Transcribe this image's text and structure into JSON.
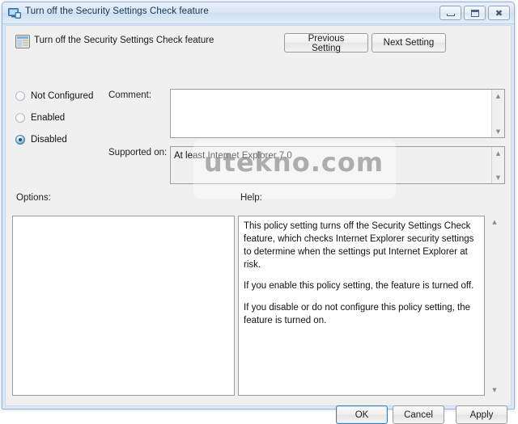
{
  "window": {
    "title": "Turn off the Security Settings Check feature",
    "title_icon": "policy-monitor-icon",
    "buttons": {
      "minimize": "minimize-icon",
      "maximize": "maximize-icon",
      "close": "close-icon"
    }
  },
  "header": {
    "icon": "policy-setting-icon",
    "policy_title": "Turn off the Security Settings Check feature",
    "previous_setting": "Previous Setting",
    "next_setting": "Next Setting"
  },
  "state_options": [
    {
      "label": "Not Configured",
      "selected": false
    },
    {
      "label": "Enabled",
      "selected": false
    },
    {
      "label": "Disabled",
      "selected": true
    }
  ],
  "fields": {
    "comment_label": "Comment:",
    "comment_value": "",
    "supported_label": "Supported on:",
    "supported_value": "At least Internet Explorer 7.0"
  },
  "panes": {
    "options_label": "Options:",
    "options_value": "",
    "help_label": "Help:",
    "help_paragraphs": [
      "This policy setting turns off the Security Settings Check feature, which checks Internet Explorer security settings to determine when the settings put Internet Explorer at risk.",
      "If you enable this policy setting, the feature is turned off.",
      "If you disable or do not configure this policy setting, the feature is turned on."
    ]
  },
  "footer": {
    "ok": "OK",
    "cancel": "Cancel",
    "apply": "Apply"
  },
  "watermark": {
    "text": "utekno.com"
  },
  "scroll_glyphs": {
    "up": "▲",
    "down": "▼"
  },
  "colors": {
    "title_bar": "#dbe7f5",
    "window_border": "#9db6d4",
    "client_bg": "#f0f0f0",
    "field_bg": "#ffffff",
    "readonly_bg": "#f0f0f0",
    "focus_accent": "#3c7fb1",
    "radio_accent": "#3d7aa8",
    "text": "#111111"
  }
}
